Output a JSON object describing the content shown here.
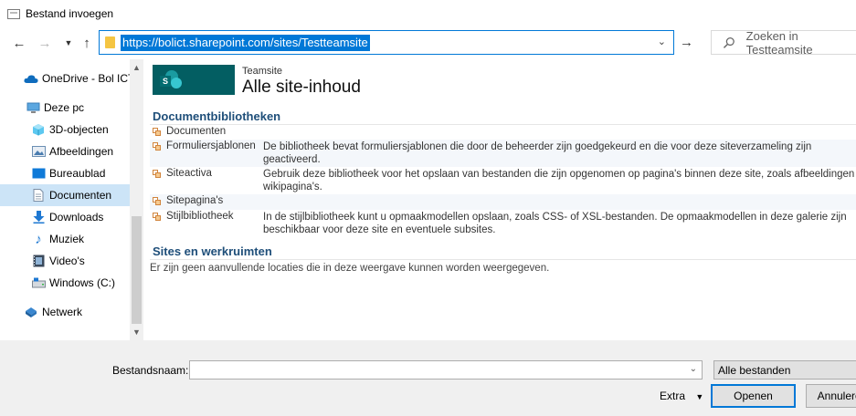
{
  "window": {
    "title": "Bestand invoegen"
  },
  "navigation": {
    "address": "https://bolict.sharepoint.com/sites/Testteamsite",
    "search_placeholder": "Zoeken in Testteamsite"
  },
  "sidebar": {
    "items": [
      {
        "label": "OneDrive - Bol ICT",
        "icon": "cloud-icon",
        "selected": false
      },
      {
        "label": "Deze pc",
        "icon": "computer-icon",
        "selected": false
      },
      {
        "label": "3D-objecten",
        "icon": "cube-icon",
        "selected": false
      },
      {
        "label": "Afbeeldingen",
        "icon": "picture-icon",
        "selected": false
      },
      {
        "label": "Bureaublad",
        "icon": "desktop-icon",
        "selected": false
      },
      {
        "label": "Documenten",
        "icon": "document-icon",
        "selected": true
      },
      {
        "label": "Downloads",
        "icon": "download-icon",
        "selected": false
      },
      {
        "label": "Muziek",
        "icon": "music-icon",
        "selected": false
      },
      {
        "label": "Video's",
        "icon": "video-icon",
        "selected": false
      },
      {
        "label": "Windows (C:)",
        "icon": "drive-icon",
        "selected": false
      },
      {
        "label": "Netwerk",
        "icon": "network-icon",
        "selected": false
      }
    ]
  },
  "site": {
    "subtitle": "Teamsite",
    "title": "Alle site-inhoud",
    "logo_letter": "S"
  },
  "libraries": {
    "heading": "Documentbibliotheken",
    "items": [
      {
        "name": "Documenten",
        "description": ""
      },
      {
        "name": "Formuliersjablonen",
        "description": "De bibliotheek bevat formuliersjablonen die door de beheerder zijn goedgekeurd en die voor deze siteverzameling zijn",
        "description2": "geactiveerd."
      },
      {
        "name": "Siteactiva",
        "description": "Gebruik deze bibliotheek voor het opslaan van bestanden die zijn opgenomen op pagina's binnen deze site, zoals afbeeldingen op",
        "description2": "wikipagina's."
      },
      {
        "name": "Sitepagina's",
        "description": ""
      },
      {
        "name": "Stijlbibliotheek",
        "description": "In de stijlbibliotheek kunt u opmaakmodellen opslaan, zoals CSS- of XSL-bestanden. De opmaakmodellen in deze galerie zijn",
        "description2": "beschikbaar voor deze site en eventuele subsites."
      }
    ]
  },
  "sites": {
    "heading": "Sites en werkruimten",
    "empty_message": "Er zijn geen aanvullende locaties die in deze weergave kunnen worden weergegeven."
  },
  "footer": {
    "filename_label": "Bestandsnaam:",
    "filename_value": "",
    "filter": "Alle bestanden",
    "extra_label": "Extra",
    "open_label": "Openen",
    "cancel_label": "Annuleren"
  },
  "colors": {
    "accent": "#0078d7",
    "selected": "#cce4f7",
    "heading": "#1e4e79",
    "banner": "#035e62"
  }
}
